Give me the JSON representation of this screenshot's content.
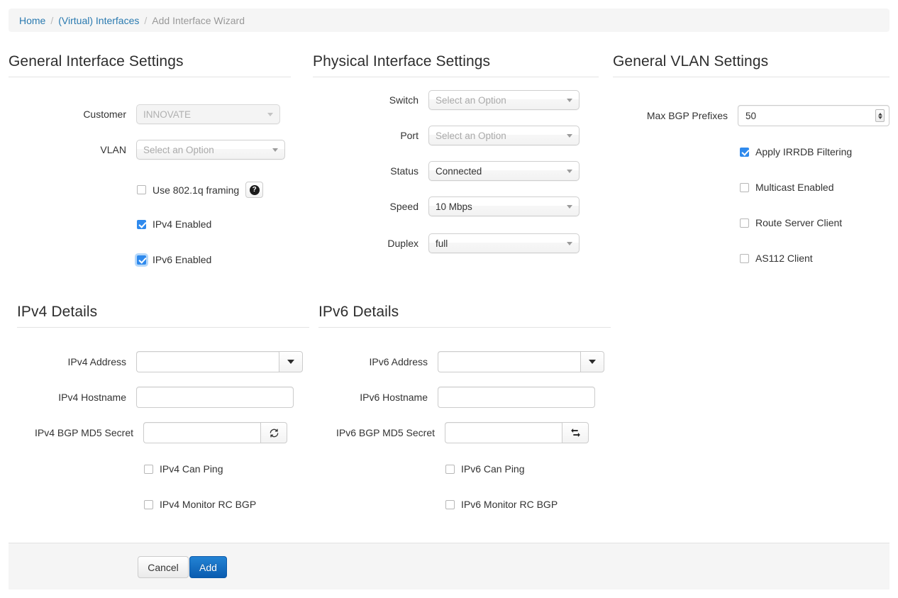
{
  "breadcrumb": {
    "home": "Home",
    "parent": "(Virtual) Interfaces",
    "current": "Add Interface Wizard",
    "separator": "/"
  },
  "general_interface": {
    "title": "General Interface Settings",
    "customer": {
      "label": "Customer",
      "value": "INNOVATE",
      "disabled": true
    },
    "vlan": {
      "label": "VLAN",
      "value": "Select an Option",
      "placeholder": "Select an Option"
    },
    "framing": {
      "label": "Use 802.1q framing",
      "checked": false,
      "help_icon": "question-circle-icon"
    },
    "ipv4_enabled": {
      "label": "IPv4 Enabled",
      "checked": true
    },
    "ipv6_enabled": {
      "label": "IPv6 Enabled",
      "checked": true
    }
  },
  "physical_interface": {
    "title": "Physical Interface Settings",
    "switch": {
      "label": "Switch",
      "value": "Select an Option",
      "placeholder": "Select an Option"
    },
    "port": {
      "label": "Port",
      "value": "Select an Option",
      "placeholder": "Select an Option"
    },
    "status": {
      "label": "Status",
      "value": "Connected"
    },
    "speed": {
      "label": "Speed",
      "value": "10 Mbps"
    },
    "duplex": {
      "label": "Duplex",
      "value": "full"
    }
  },
  "general_vlan": {
    "title": "General VLAN Settings",
    "max_bgp_prefixes": {
      "label": "Max BGP Prefixes",
      "value": "50"
    },
    "irrdb": {
      "label": "Apply IRRDB Filtering",
      "checked": true
    },
    "multicast": {
      "label": "Multicast Enabled",
      "checked": false
    },
    "route_server": {
      "label": "Route Server Client",
      "checked": false
    },
    "as112": {
      "label": "AS112 Client",
      "checked": false
    }
  },
  "ipv4_details": {
    "title": "IPv4 Details",
    "address": {
      "label": "IPv4 Address",
      "value": "",
      "icon": "caret-down-icon"
    },
    "hostname": {
      "label": "IPv4 Hostname",
      "value": ""
    },
    "md5": {
      "label": "IPv4 BGP MD5 Secret",
      "value": "",
      "icon": "refresh-icon"
    },
    "can_ping": {
      "label": "IPv4 Can Ping",
      "checked": false
    },
    "monitor_rc_bgp": {
      "label": "IPv4 Monitor RC BGP",
      "checked": false
    }
  },
  "ipv6_details": {
    "title": "IPv6 Details",
    "address": {
      "label": "IPv6 Address",
      "value": "",
      "icon": "caret-down-icon"
    },
    "hostname": {
      "label": "IPv6 Hostname",
      "value": ""
    },
    "md5": {
      "label": "IPv6 BGP MD5 Secret",
      "value": "",
      "icon": "retweet-icon"
    },
    "can_ping": {
      "label": "IPv6 Can Ping",
      "checked": false
    },
    "monitor_rc_bgp": {
      "label": "IPv6 Monitor RC BGP",
      "checked": false
    }
  },
  "footer": {
    "cancel": "Cancel",
    "add": "Add"
  },
  "colors": {
    "link": "#2a7ab0",
    "accent_blue": "#2f8aed",
    "primary_button": "#0a5cb0",
    "panel_bg": "#f5f5f5"
  }
}
